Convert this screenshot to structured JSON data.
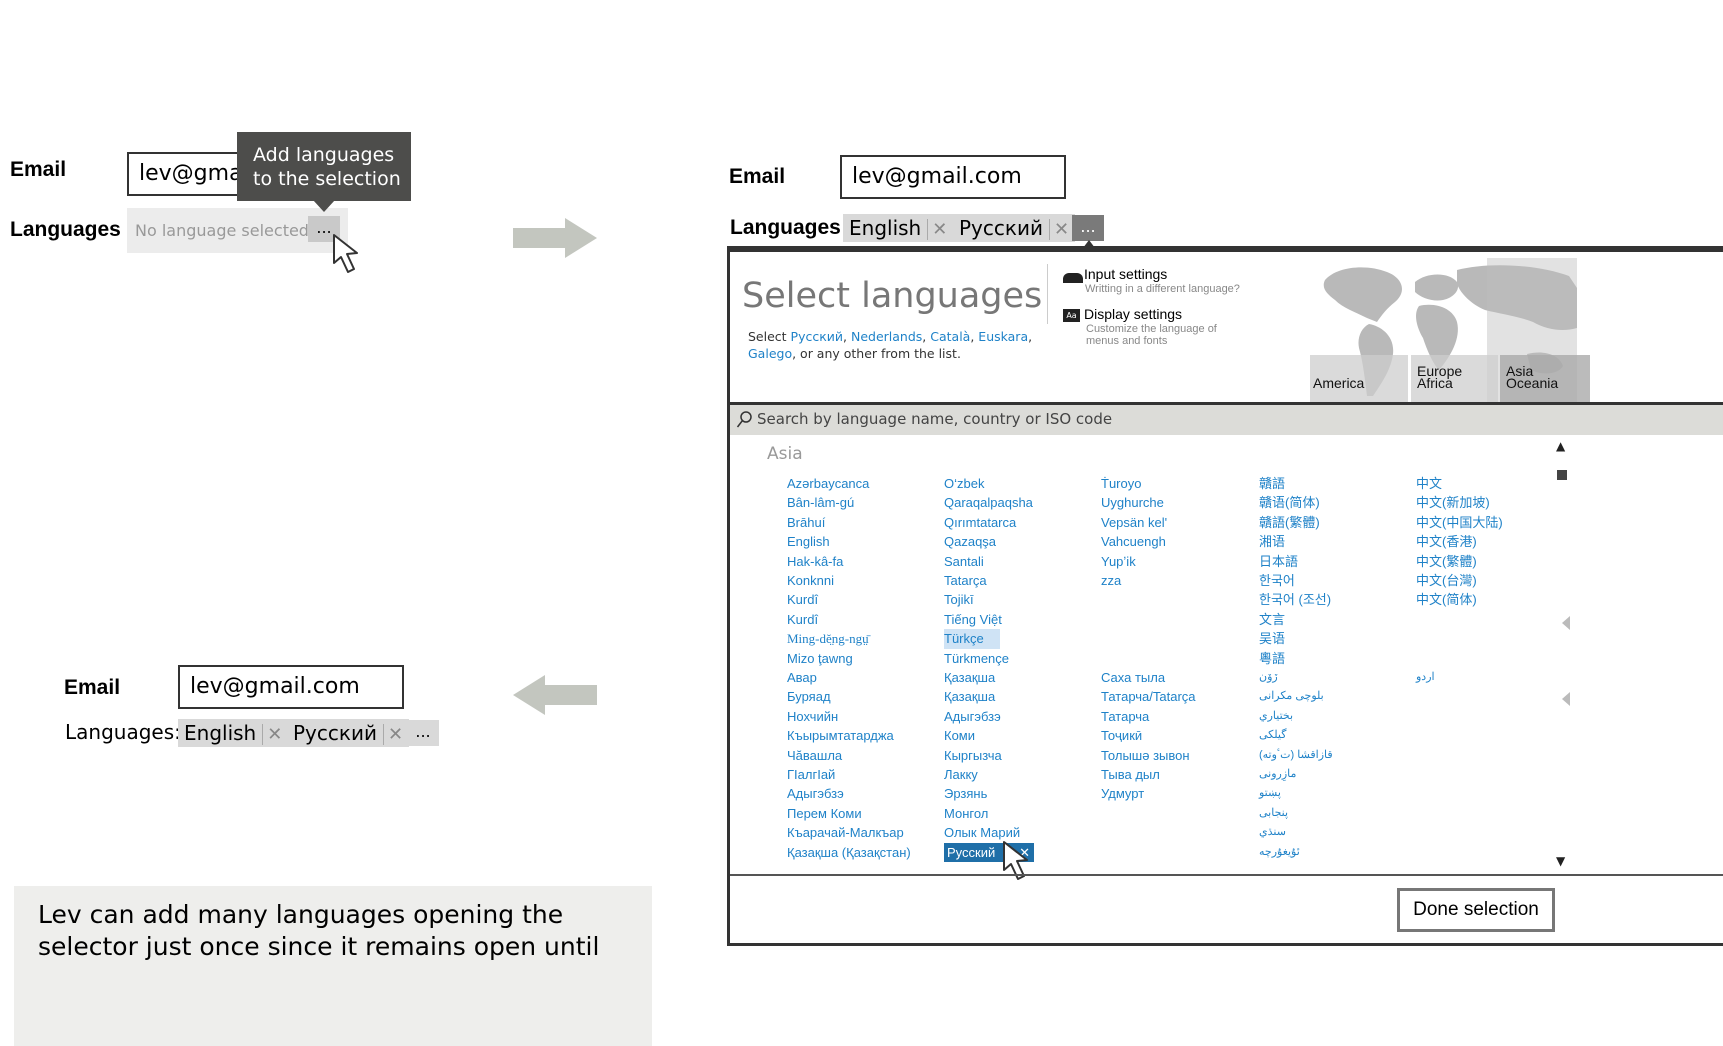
{
  "step1": {
    "email_label": "Email",
    "email_value": "lev@gmail.",
    "languages_label": "Languages",
    "placeholder": "No language selected",
    "more_button": "...",
    "tooltip": [
      "Add languages",
      "to the selection"
    ]
  },
  "step2": {
    "email_label": "Email",
    "email_value": "lev@gmail.com",
    "languages_label": "Languages",
    "chips": [
      {
        "label": "English",
        "remove": "✕"
      },
      {
        "label": "Русский",
        "remove": "✕"
      }
    ],
    "more_button": "..."
  },
  "dialog": {
    "title": "Select languages",
    "suggest_prefix": "Select ",
    "suggestions": [
      "Русский",
      "Nederlands",
      "Català",
      "Euskara",
      "Galego"
    ],
    "suggest_suffix": ", or any other from the list.",
    "input_settings": {
      "title": "Input settings",
      "subtitle": "Writting in a different language?"
    },
    "display_settings": {
      "title": "Display settings",
      "subtitle_lines": [
        "Customize the language of",
        "menus and fonts"
      ],
      "icon_text": "Aa"
    },
    "regions": [
      {
        "name": "America"
      },
      {
        "name": "Europe Africa",
        "lines": [
          "Europe",
          "Africa"
        ]
      },
      {
        "name": "Asia Oceania",
        "lines": [
          "Asia",
          "Oceania"
        ]
      }
    ],
    "search_placeholder": "Search by language name, country or ISO code",
    "section_title": "Asia",
    "latin_columns": [
      [
        "Azərbaycanca",
        "Bân-lâm-gú",
        "Brāhuí",
        "English",
        "Hak-kâ-fa",
        "Konknni",
        "Kurdî",
        "Kurdî",
        "Ming-dĕ̤ng-ngṳ̄",
        "Mizo ţawng"
      ],
      [
        "O‘zbek",
        "Qaraqalpaqsha",
        "Qırımtatarca",
        "Qazaqşa",
        "Santali",
        "Tatarça",
        "Tojikī",
        "Tiếng Việt",
        "Türkçe",
        "Türkmençe"
      ],
      [
        "Ṫuroyo",
        "Uyghurche",
        "Vepsän kel'",
        "Vahcuengh",
        "Yupʼik",
        "zza"
      ],
      [
        "贛語",
        "贛语(简体)",
        "贛語(繁體)",
        "湘语",
        "日本語",
        "한국어",
        "한국어 (조선)",
        "文言",
        "吴语",
        "粵語"
      ],
      [
        "中文",
        "中文(新加坡)",
        "中文(中国大陆)",
        "中文(香港)",
        "中文(繁體)",
        "中文(台灣)",
        "中文(简体)"
      ]
    ],
    "other_columns": [
      [
        "Авар",
        "Буряад",
        "Нохчийн",
        "Къырымтатарджа",
        "Чăвашла",
        "ГӀалгӀай",
        "Адыгэбзэ",
        "Перем Коми",
        "Къарачай-Малкъар",
        "Қазақша (Қазақстан)"
      ],
      [
        "Қазақша",
        "Қазақша",
        "Адыгэбзэ",
        "Коми",
        "Кыргызча",
        "Лакку",
        "Эрзянь",
        "Монгол",
        "Олык Марий",
        "Русский"
      ],
      [
        "Саха тыла",
        "Татарча/Tatarça",
        "Татарча",
        "Тоҷикӣ",
        "Толышә зывон",
        "Тыва дыл",
        "Удмурт"
      ],
      [
        "ڒوٚن",
        "بلوچی مکرانی",
        "بختياري",
        "گیلکی",
        "قازاقشا (تٴوتە)",
        "مازِرونی",
        "پښتو",
        "پنجابی",
        "سنڌي",
        "ئۇيغۇرچە"
      ],
      [
        "اردو"
      ]
    ],
    "highlighted_item": "Türkçe",
    "selected_item": "Русский",
    "selected_remove": "✕",
    "scroll_up": "▲",
    "scroll_down": "▼",
    "done_button": "Done selection"
  },
  "step3": {
    "email_label": "Email",
    "email_value": "lev@gmail.com",
    "languages_label": "Languages:",
    "chips": [
      {
        "label": "English",
        "remove": "✕"
      },
      {
        "label": "Русский",
        "remove": "✕"
      }
    ],
    "more_button": "..."
  },
  "caption": {
    "lines": [
      "Lev can add many languages opening the",
      "selector just once since it remains open until"
    ]
  },
  "colors": {
    "tooltip_bg": "#4d4d4b",
    "arrow": "#c3c6bf",
    "link": "#1f82c8",
    "selected_bg": "#1f6fa8",
    "highlight_bg": "#cfe3f5"
  }
}
